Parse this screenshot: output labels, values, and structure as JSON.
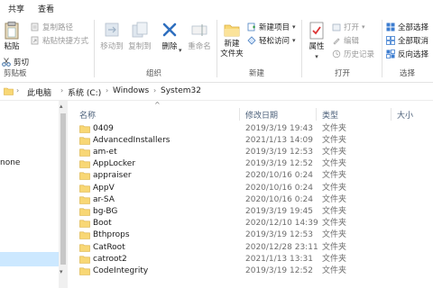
{
  "tabs": {
    "share": "共享",
    "view": "查看"
  },
  "ribbon": {
    "clipboard": {
      "pin_label": "固定到快速访问",
      "paste_label": "粘贴",
      "cut_label": "剪切",
      "copy_path_label": "复制路径",
      "paste_shortcut_label": "粘贴快捷方式",
      "group_label": "剪贴板"
    },
    "organize": {
      "move_to_label": "移动到",
      "copy_to_label": "复制到",
      "delete_label": "删除",
      "rename_label": "重命名",
      "group_label": "组织"
    },
    "new": {
      "new_folder_label": "新建\n文件夹",
      "new_item_label": "新建项目",
      "easy_access_label": "轻松访问",
      "group_label": "新建"
    },
    "open": {
      "properties_label": "属性",
      "open_label": "打开",
      "edit_label": "编辑",
      "history_label": "历史记录",
      "group_label": "打开"
    },
    "select": {
      "select_all_label": "全部选择",
      "select_none_label": "全部取消",
      "invert_label": "反向选择",
      "group_label": "选择"
    }
  },
  "address": {
    "crumbs": [
      "此电脑",
      "系统 (C:)",
      "Windows",
      "System32"
    ]
  },
  "nav": {
    "partial_item": "none"
  },
  "list": {
    "columns": {
      "name": "名称",
      "date": "修改日期",
      "type": "类型",
      "size": "大小"
    },
    "rows": [
      {
        "name": "0409",
        "date": "2019/3/19 19:43",
        "type": "文件夹"
      },
      {
        "name": "AdvancedInstallers",
        "date": "2021/1/13 14:09",
        "type": "文件夹"
      },
      {
        "name": "am-et",
        "date": "2019/3/19 12:53",
        "type": "文件夹"
      },
      {
        "name": "AppLocker",
        "date": "2019/3/19 12:52",
        "type": "文件夹"
      },
      {
        "name": "appraiser",
        "date": "2020/10/16 0:24",
        "type": "文件夹"
      },
      {
        "name": "AppV",
        "date": "2020/10/16 0:24",
        "type": "文件夹"
      },
      {
        "name": "ar-SA",
        "date": "2020/10/16 0:24",
        "type": "文件夹"
      },
      {
        "name": "bg-BG",
        "date": "2019/3/19 19:45",
        "type": "文件夹"
      },
      {
        "name": "Boot",
        "date": "2020/12/10 14:39",
        "type": "文件夹"
      },
      {
        "name": "Bthprops",
        "date": "2019/3/19 12:53",
        "type": "文件夹"
      },
      {
        "name": "CatRoot",
        "date": "2020/12/28 23:11",
        "type": "文件夹"
      },
      {
        "name": "catroot2",
        "date": "2021/1/13 13:31",
        "type": "文件夹"
      },
      {
        "name": "CodeIntegrity",
        "date": "2019/3/19 12:52",
        "type": "文件夹"
      }
    ]
  }
}
